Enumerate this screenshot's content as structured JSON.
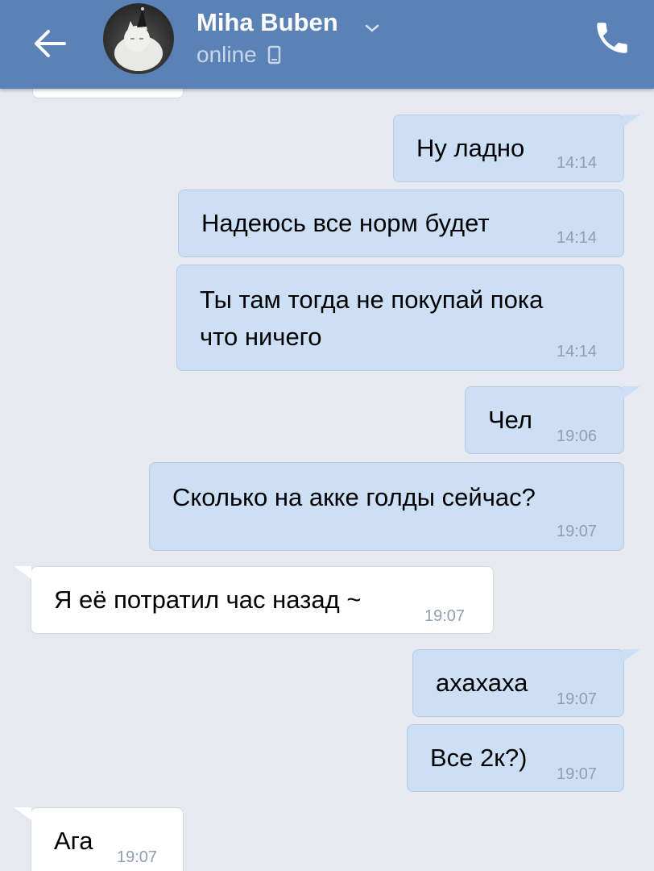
{
  "header": {
    "contact_name": "Miha Buben",
    "status": "online",
    "colors": {
      "bar": "#5b82b6",
      "outgoing": "#ccdff5",
      "incoming": "#ffffff",
      "background": "#e6eaf0"
    },
    "icons": [
      "back-arrow-icon",
      "chevron-down-icon",
      "mobile-device-icon",
      "phone-icon"
    ]
  },
  "messages": [
    {
      "direction": "outgoing",
      "text": "Ну ладно",
      "time": "14:14"
    },
    {
      "direction": "outgoing",
      "text": "Надеюсь все норм будет",
      "time": "14:14"
    },
    {
      "direction": "outgoing",
      "text": "Ты там тогда не покупай пока\nчто ничего",
      "time": "14:14"
    },
    {
      "direction": "outgoing",
      "text": "Чел",
      "time": "19:06"
    },
    {
      "direction": "outgoing",
      "text": "Сколько на акке голды сейчас?",
      "time": "19:07"
    },
    {
      "direction": "incoming",
      "text": "Я её потратил час назад ~",
      "time": "19:07"
    },
    {
      "direction": "outgoing",
      "text": "ахахаха",
      "time": "19:07"
    },
    {
      "direction": "outgoing",
      "text": "Все 2к?)",
      "time": "19:07"
    },
    {
      "direction": "incoming",
      "text": "Ага",
      "time": "19:07"
    }
  ]
}
